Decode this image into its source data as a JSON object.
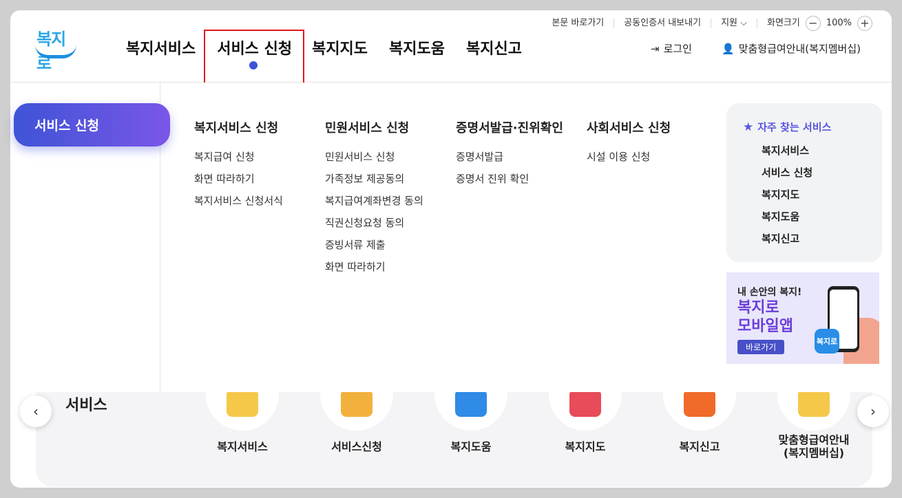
{
  "utility": {
    "skip_to_content": "본문 바로가기",
    "cert_export": "공동인증서 내보내기",
    "language": "지원",
    "screen_size_label": "화면크기",
    "zoom_value": "100%"
  },
  "logo": {
    "text": "복지로"
  },
  "gnb": {
    "items": [
      "복지서비스",
      "서비스 신청",
      "복지지도",
      "복지도움",
      "복지신고"
    ],
    "active_index": 1
  },
  "header_actions": {
    "login": "로그인",
    "membership": "맞춤형급여안내(복지멤버십)"
  },
  "mega_menu": {
    "side_title": "서비스 신청",
    "columns": [
      {
        "title": "복지서비스 신청",
        "items": [
          "복지급여 신청",
          "화면 따라하기",
          "복지서비스 신청서식"
        ]
      },
      {
        "title": "민원서비스 신청",
        "items": [
          "민원서비스 신청",
          "가족정보 제공동의",
          "복지급여계좌변경 동의",
          "직권신청요청 동의",
          "증빙서류 제출",
          "화면 따라하기"
        ]
      },
      {
        "title": "증명서발급·진위확인",
        "items": [
          "증명서발급",
          "증명서 진위 확인"
        ]
      },
      {
        "title": "사회서비스 신청",
        "items": [
          "시설 이용 신청"
        ]
      }
    ]
  },
  "favorites": {
    "title": "자주 찾는 서비스",
    "items": [
      "복지서비스",
      "서비스 신청",
      "복지지도",
      "복지도움",
      "복지신고"
    ]
  },
  "banner": {
    "small": "내 손안의 복지!",
    "big_line1": "복지로",
    "big_line2": "모바일앱",
    "button": "바로가기",
    "app_icon_text": "복지로"
  },
  "background": {
    "title": "서비스",
    "services": [
      {
        "label": "복지서비스",
        "color": "#f5c84a"
      },
      {
        "label": "서비스신청",
        "color": "#f2b13c"
      },
      {
        "label": "복지도움",
        "color": "#2f8be6"
      },
      {
        "label": "복지지도",
        "color": "#e84b5a"
      },
      {
        "label": "복지신고",
        "color": "#f06a2a"
      },
      {
        "label": "맞춤형급여안내\n(복지멤버십)",
        "label_line1": "맞춤형급여안내",
        "label_line2": "(복지멤버십)",
        "color": "#f5c84a"
      }
    ]
  }
}
